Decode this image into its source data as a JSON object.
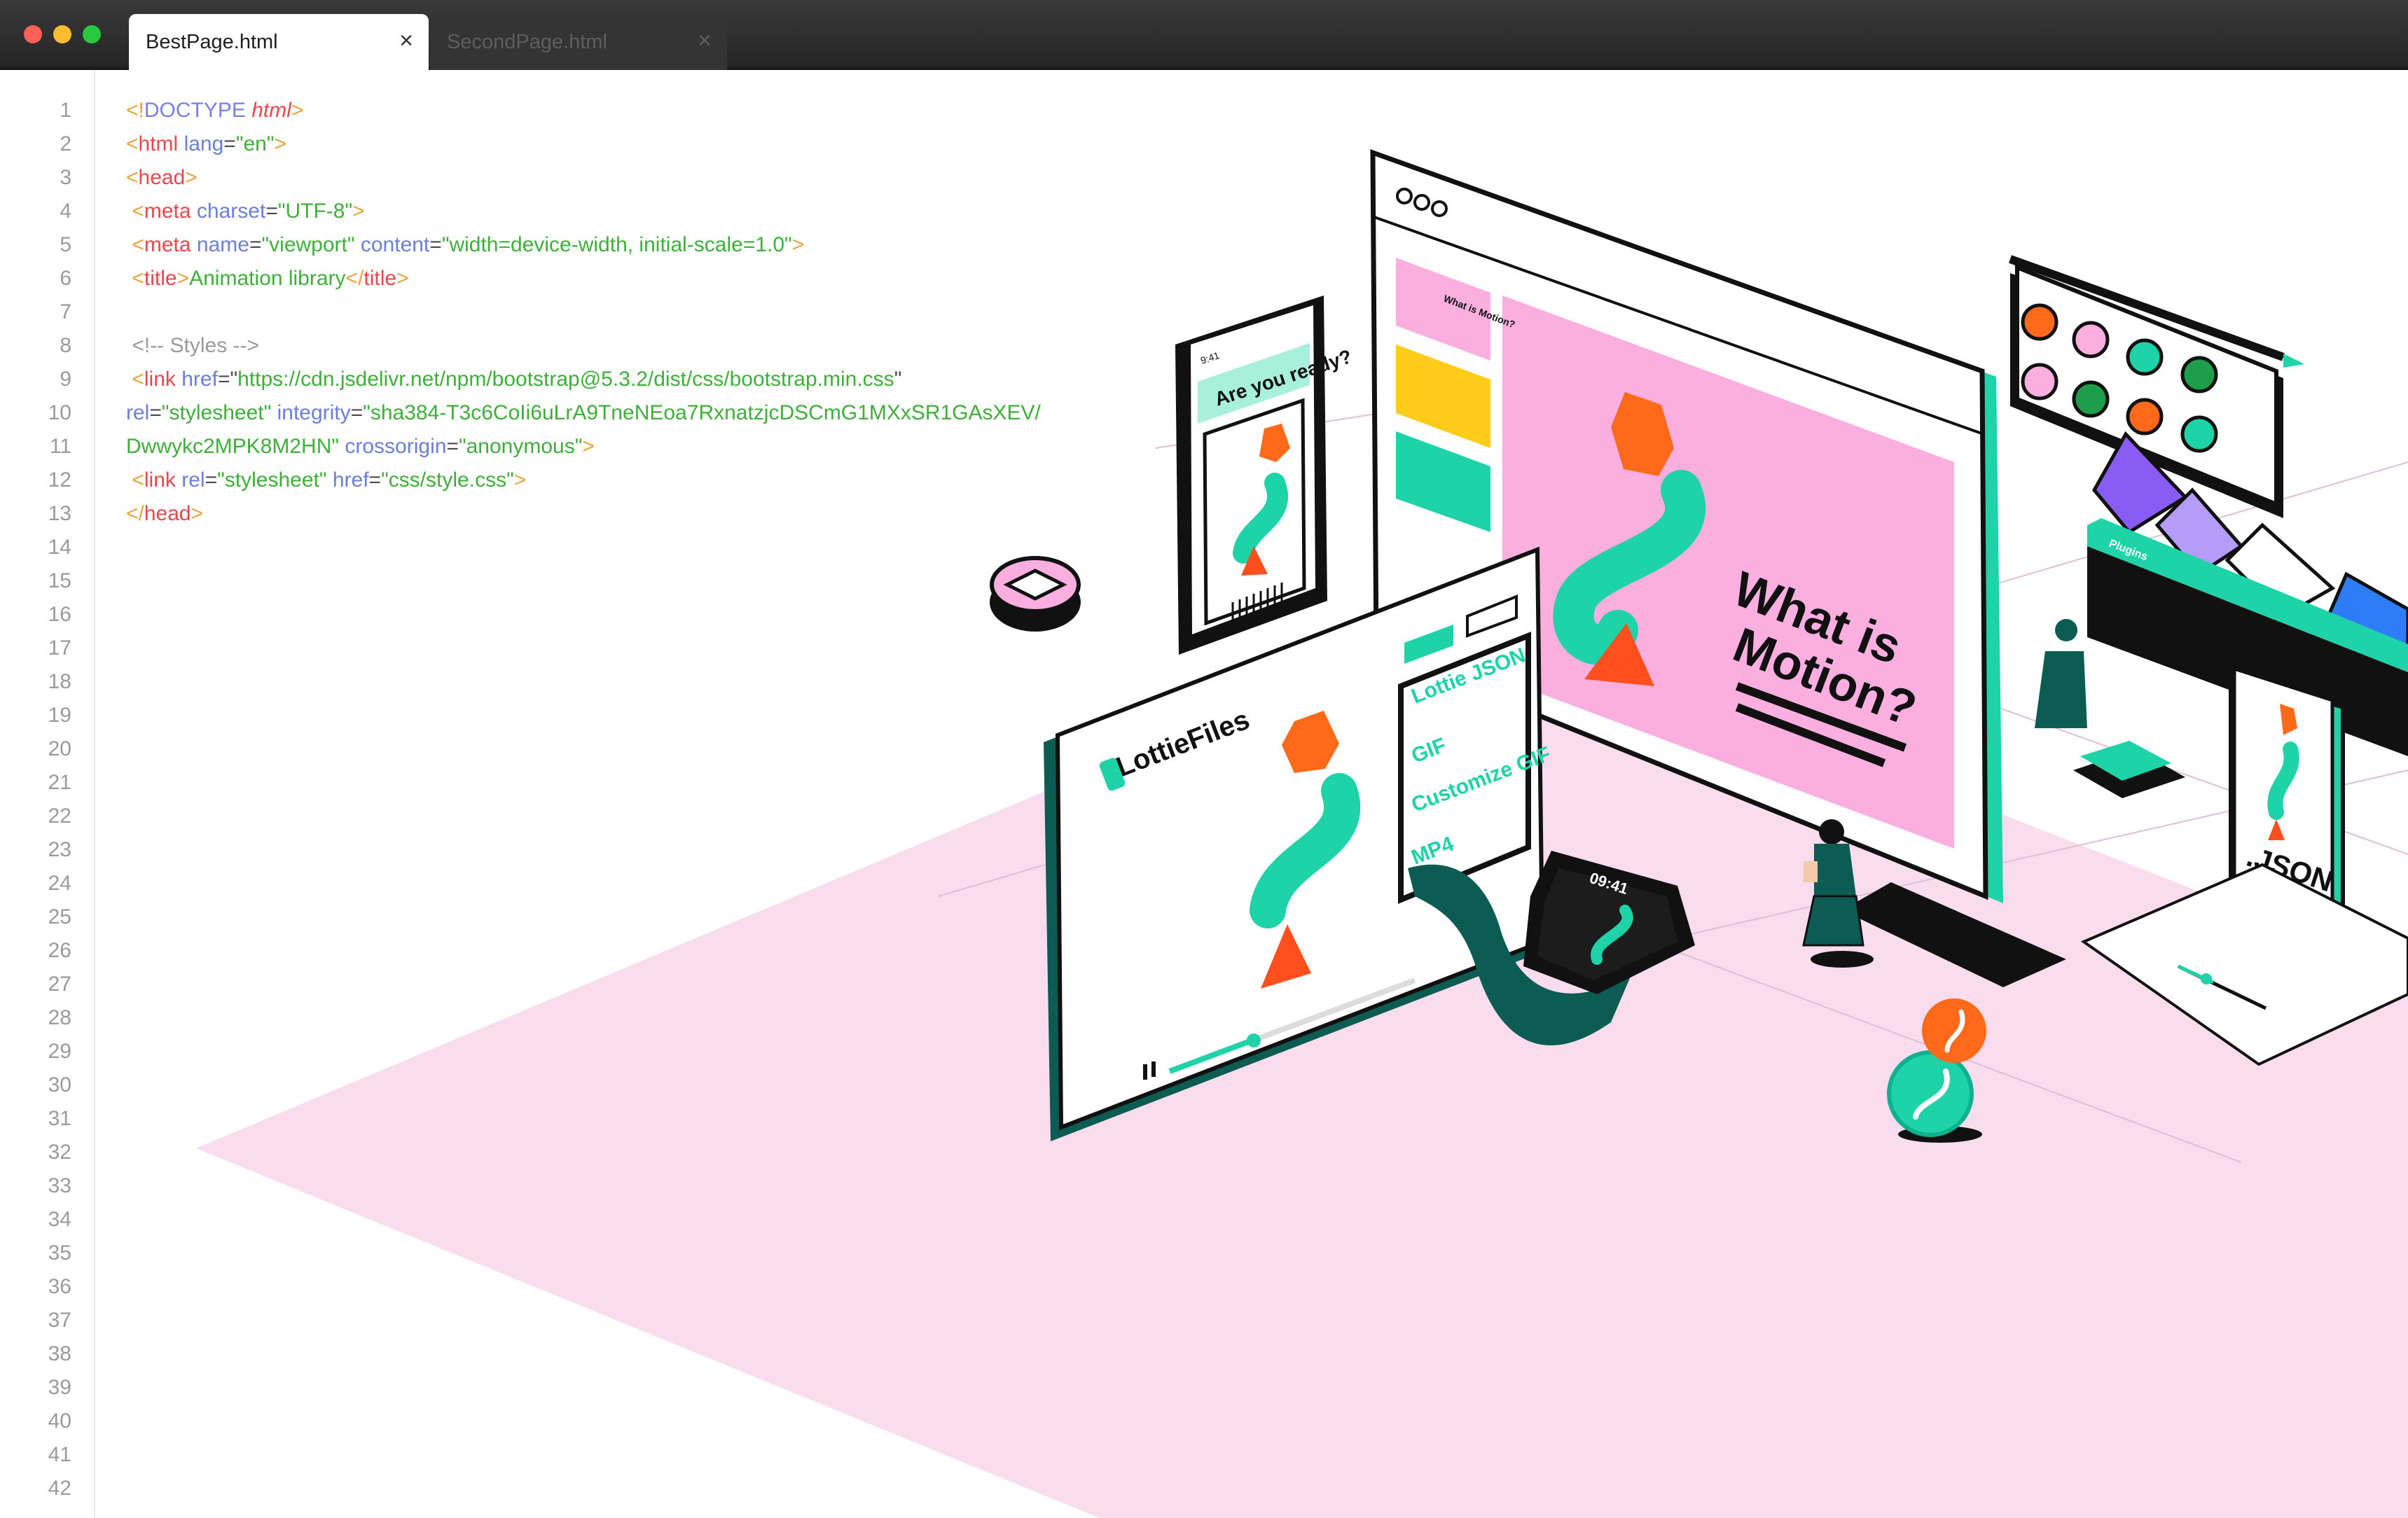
{
  "window": {
    "tabs": [
      {
        "label": "BestPage.html",
        "close": "×",
        "active": true
      },
      {
        "label": "SecondPage.html",
        "close": "×",
        "active": false
      }
    ]
  },
  "editor": {
    "line_numbers": [
      "1",
      "2",
      "3",
      "4",
      "5",
      "6",
      "7",
      "8",
      "9",
      "10",
      "11",
      "12",
      "13",
      "14",
      "15",
      "16",
      "17",
      "18",
      "19",
      "20",
      "21",
      "22",
      "23",
      "24",
      "25",
      "26",
      "27",
      "28",
      "29",
      "30",
      "31",
      "32",
      "33",
      "34",
      "35",
      "36",
      "37",
      "38",
      "39",
      "40",
      "41",
      "42"
    ],
    "code": {
      "l1": {
        "open": "<!",
        "kw": "DOCTYPE",
        "sp": " ",
        "val": "html",
        "close": ">"
      },
      "l2": {
        "open": "<",
        "tag": "html",
        "sp": " ",
        "attr": "lang",
        "eq": "=",
        "val": "\"en\"",
        "close": ">"
      },
      "l3": {
        "open": "<",
        "tag": "head",
        "close": ">"
      },
      "l4": {
        "indent": " ",
        "open": "<",
        "tag": "meta",
        "sp": " ",
        "attr": "charset",
        "eq": "=",
        "val": "\"UTF-8\"",
        "close": ">"
      },
      "l5": {
        "indent": " ",
        "open": "<",
        "tag": "meta",
        "sp1": " ",
        "attr1": "name",
        "eq1": "=",
        "val1": "\"viewport\"",
        "sp2": " ",
        "attr2": "content",
        "eq2": "=",
        "val2": "\"width=device-width, initial-scale=1.0\"",
        "close": ">"
      },
      "l6": {
        "indent": " ",
        "open": "<",
        "tag": "title",
        "close": ">",
        "text": "Animation library",
        "open2": "</",
        "tag2": "title",
        "close2": ">"
      },
      "l8": {
        "comment": " <!-- Styles -->"
      },
      "l9": {
        "indent": " ",
        "open": "<",
        "tag": "link",
        "sp": " ",
        "attr": "href",
        "eq": "=",
        "q1": "\"",
        "val": "https://cdn.jsdelivr.net/npm/bootstrap@5.3.2/dist/css/bootstrap.min.css",
        "q2": "\""
      },
      "l10": {
        "attr1": "rel",
        "eq1": "=",
        "val1": "\"stylesheet\"",
        "sp": " ",
        "attr2": "integrity",
        "eq2": "=",
        "val2": "\"sha384-T3c6CoIi6uLrA9TneNEoa7RxnatzjcDSCmG1MXxSR1GAsXEV/"
      },
      "l11": {
        "val": "Dwwykc2MPK8M2HN\"",
        "sp": " ",
        "attr": "crossorigin",
        "eq": "=",
        "val2": "\"anonymous\"",
        "close": ">"
      },
      "l12": {
        "indent": " ",
        "open": "<",
        "tag": "link",
        "sp1": " ",
        "attr1": "rel",
        "eq1": "=",
        "val1": "\"stylesheet\"",
        "sp2": " ",
        "attr2": "href",
        "eq2": "=",
        "val2": "\"css/style.css\"",
        "close": ">"
      },
      "l13": {
        "open": "</",
        "tag": "head",
        "close": ">"
      }
    }
  },
  "illustration": {
    "phone_heading": "Are you ready?",
    "phone_time": "9:41",
    "player_logo": "LottieFiles",
    "menu_items": [
      "Lottie JSON",
      "GIF",
      "Customize GIF",
      "MP4"
    ],
    "slide_title_line1": "What is",
    "slide_title_line2": "Motion?",
    "thumb_label": "What is Motion?",
    "plugins_label": "Plugins",
    "json_label": ".JSON",
    "watch_time": "09:41",
    "colors": {
      "teal": "#1ed3a8",
      "dark_teal": "#0d5c54",
      "pink": "#fbaee0",
      "floor": "#f9dcee",
      "orange": "#ff6a1a",
      "red_orange": "#ff4f1f",
      "purple": "#8a5cf6",
      "blue": "#2f7df6",
      "yellow": "#ffcc1a"
    }
  }
}
